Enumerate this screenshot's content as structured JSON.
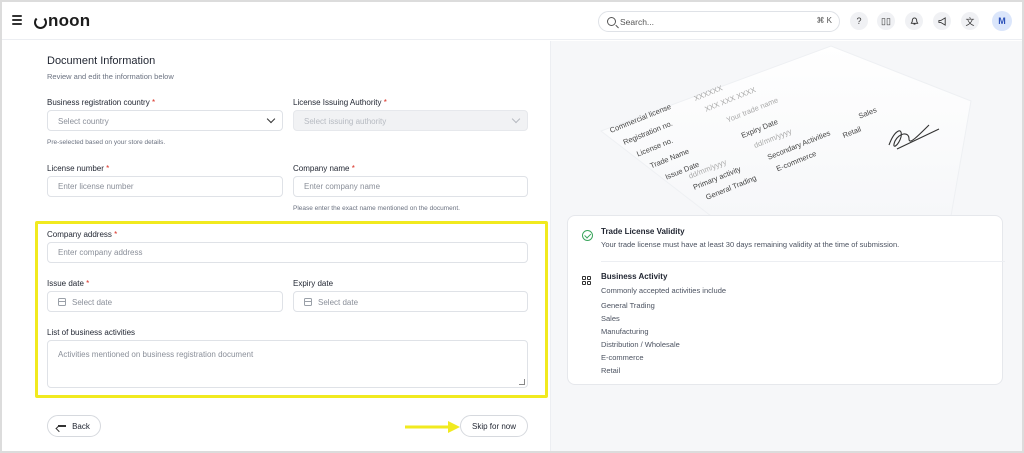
{
  "header": {
    "logo_text": "noon",
    "search": {
      "placeholder": "Search...",
      "shortcut": "⌘ K"
    },
    "icons": [
      "help-icon",
      "book-icon",
      "bell-icon",
      "megaphone-icon",
      "translate-icon"
    ],
    "avatar_initial": "M"
  },
  "form": {
    "title": "Document Information",
    "subtitle": "Review and edit the information below",
    "business_country": {
      "label": "Business registration country",
      "placeholder": "Select country",
      "hint": "Pre-selected based on your store details."
    },
    "license_authority": {
      "label": "License Issuing Authority",
      "placeholder": "Select issuing authority"
    },
    "license_number": {
      "label": "License number",
      "placeholder": "Enter license number"
    },
    "company_name": {
      "label": "Company name",
      "placeholder": "Enter company name",
      "hint": "Please enter the exact name mentioned on the document."
    },
    "company_address": {
      "label": "Company address",
      "placeholder": "Enter company address"
    },
    "issue_date": {
      "label": "Issue date",
      "placeholder": "Select date"
    },
    "expiry_date": {
      "label": "Expiry date",
      "placeholder": "Select date"
    },
    "activities": {
      "label": "List of business activities",
      "placeholder": "Activities mentioned on business registration document"
    },
    "required_mark": "*",
    "back_label": "Back",
    "skip_label": "Skip for now"
  },
  "illustration": {
    "rows": [
      "Commercial license",
      "Registration no.",
      "License no.",
      "Trade Name",
      "Issue Date",
      "Primary activity",
      "General Trading"
    ],
    "values": [
      "XXXXXX",
      "XXX XXX XXXX",
      "Your trade name",
      "Expiry Date",
      "dd/mm/yyyy",
      "dd/mm/yyyy",
      "Secondary Activities",
      "E-commerce",
      "Retail",
      "Sales"
    ]
  },
  "info": {
    "validity_title": "Trade License Validity",
    "validity_desc": "Your trade license must have at least 30 days remaining validity at the time of submission.",
    "activity_title": "Business Activity",
    "activity_desc": "Commonly accepted activities include",
    "activities": [
      "General Trading",
      "Sales",
      "Manufacturing",
      "Distribution / Wholesale",
      "E-commerce",
      "Retail"
    ]
  },
  "colors": {
    "highlight": "#f1ea1f",
    "check": "#3aa55c",
    "required": "#d93025",
    "avatar_bg": "#dbe6fb"
  }
}
